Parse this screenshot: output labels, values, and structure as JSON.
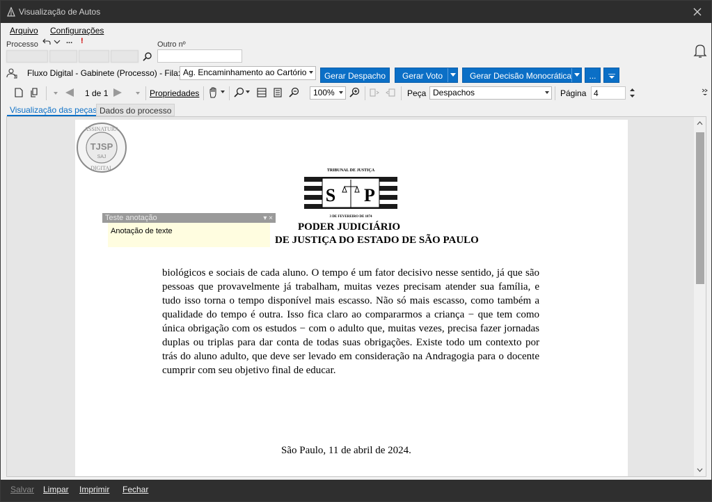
{
  "window": {
    "title": "Visualização de Autos"
  },
  "menu": {
    "arquivo": "Arquivo",
    "configuracoes": "Configurações"
  },
  "header": {
    "processo_label": "Processo",
    "outro_label": "Outro nº",
    "outro_value": "",
    "exclamation": "!",
    "more": "..."
  },
  "workflow": {
    "text": "Fluxo Digital - Gabinete (Processo) - Fila:",
    "fila_value": "Ag. Encaminhamento ao Cartório",
    "btn_despacho": "Gerar Despacho",
    "btn_voto": "Gerar Voto",
    "btn_decisao": "Gerar Decisão Monocrática",
    "btn_more": "...",
    "accent": "#0b6fc6"
  },
  "toolbar": {
    "page_of": "1 de 1",
    "propriedades": "Propriedades",
    "zoom": "100%",
    "peca_label": "Peça",
    "peca_value": "Despachos",
    "pagina_label": "Página",
    "pagina_value": "4"
  },
  "tabs": {
    "pecas": "Visualização das peças",
    "dados": "Dados do processo"
  },
  "document": {
    "seal_top": "ASSINATURA",
    "seal_center": "TJSP",
    "seal_saj": "SAJ",
    "seal_bottom": "DIGITAL",
    "logo_top": "TRIBUNAL DE JUSTIÇA",
    "logo_left": "S",
    "logo_right": "P",
    "logo_date": "3 DE FEVEREIRO DE 1874",
    "heading1": "PODER JUDICIÁRIO",
    "heading2": "DE JUSTIÇA DO ESTADO DE SÃO PAULO",
    "body": "biológicos e sociais de cada aluno. O tempo é um fator decisivo nesse sentido, já que são pessoas que provavelmente já trabalham, muitas vezes precisam atender sua família, e tudo isso torna o tempo disponível mais escasso. Não só mais escasso, como também a qualidade do tempo é outra. Isso fica claro ao compararmos a criança − que tem como única obrigação com os estudos − com o adulto que, muitas vezes, precisa fazer jornadas duplas ou triplas para dar conta de todas suas obrigações. Existe todo um contexto por trás do aluno adulto, que deve ser levado em consideração na Andragogia para o docente cumprir com seu objetivo final de educar.",
    "date": "São Paulo, 11 de abril de 2024."
  },
  "annotation": {
    "title": "Teste anotação",
    "text": "Anotação de texte",
    "controls": "▾ ×"
  },
  "footer": {
    "salvar": "Salvar",
    "limpar": "Limpar",
    "imprimir": "Imprimir",
    "fechar": "Fechar"
  }
}
